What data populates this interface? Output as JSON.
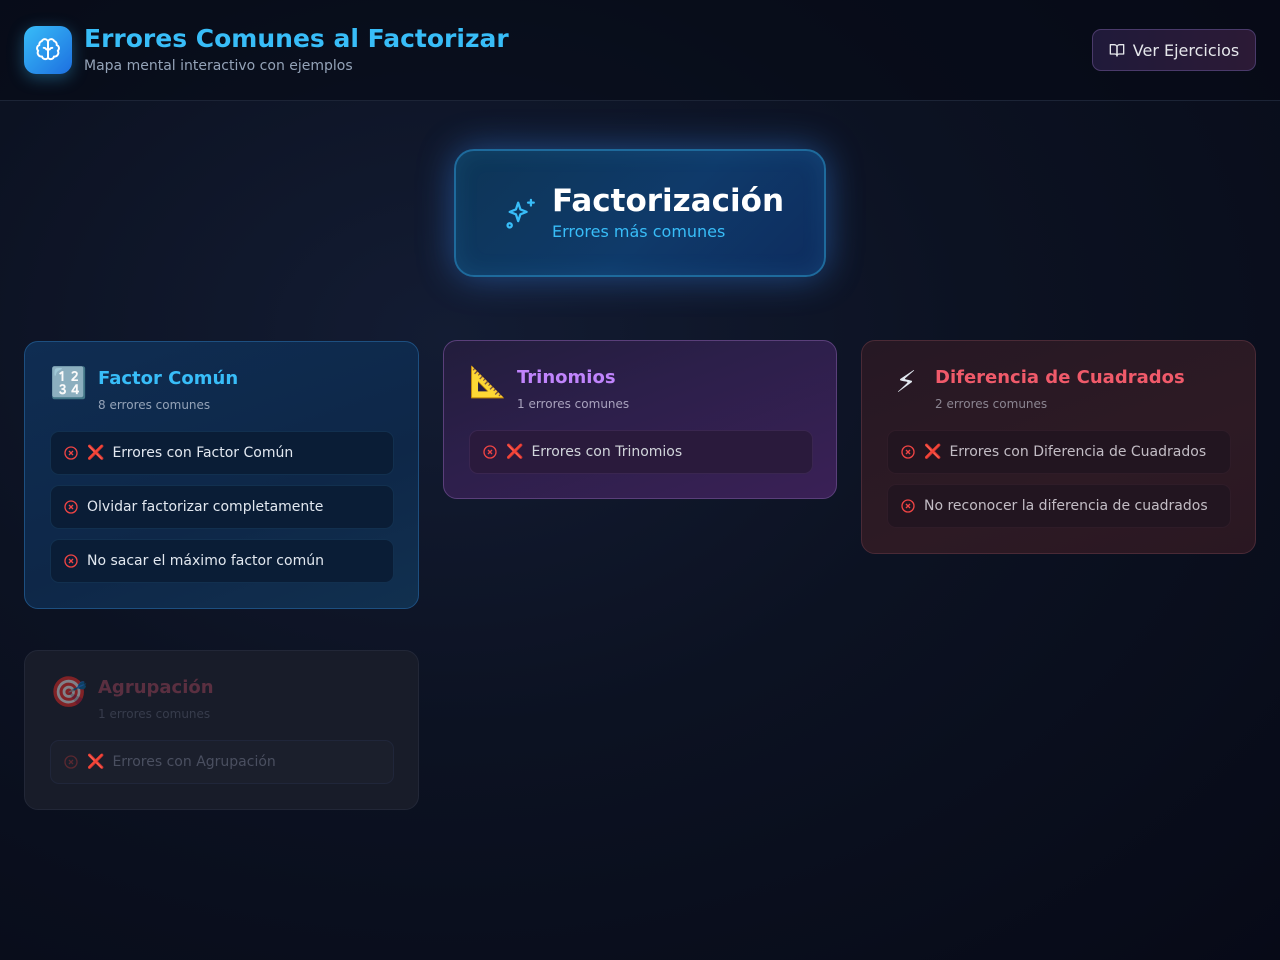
{
  "header": {
    "title": "Errores Comunes al Factorizar",
    "subtitle": "Mapa mental interactivo con ejemplos",
    "exercises_button": "Ver Ejercicios"
  },
  "center": {
    "title": "Factorización",
    "subtitle": "Errores más comunes"
  },
  "cards": [
    {
      "emoji": "🔢",
      "title": "Factor Común",
      "count": "8 errores comunes",
      "items": [
        {
          "mark": "❌",
          "text": "Errores con Factor Común"
        },
        {
          "mark": "",
          "text": "Olvidar factorizar completamente"
        },
        {
          "mark": "",
          "text": "No sacar el máximo factor común"
        }
      ]
    },
    {
      "emoji": "📐",
      "title": "Trinomios",
      "count": "1 errores comunes",
      "items": [
        {
          "mark": "❌",
          "text": "Errores con Trinomios"
        }
      ]
    },
    {
      "emoji": "⚡",
      "title": "Diferencia de Cuadrados",
      "count": "2 errores comunes",
      "items": [
        {
          "mark": "❌",
          "text": "Errores con Diferencia de Cuadrados"
        },
        {
          "mark": "",
          "text": "No reconocer la diferencia de cuadrados"
        }
      ]
    },
    {
      "emoji": "🎯",
      "title": "Agrupación",
      "count": "1 errores comunes",
      "items": [
        {
          "mark": "❌",
          "text": "Errores con Agrupación"
        }
      ]
    }
  ],
  "colors": {
    "accent": "#38bdf8",
    "trinomios": "#c084fc",
    "diferencia": "#f05a6a",
    "error_icon": "#ef4444"
  },
  "icons": {
    "logo": "brain-icon",
    "button": "book-open-icon",
    "center": "sparkles-icon",
    "item": "x-circle-icon"
  }
}
